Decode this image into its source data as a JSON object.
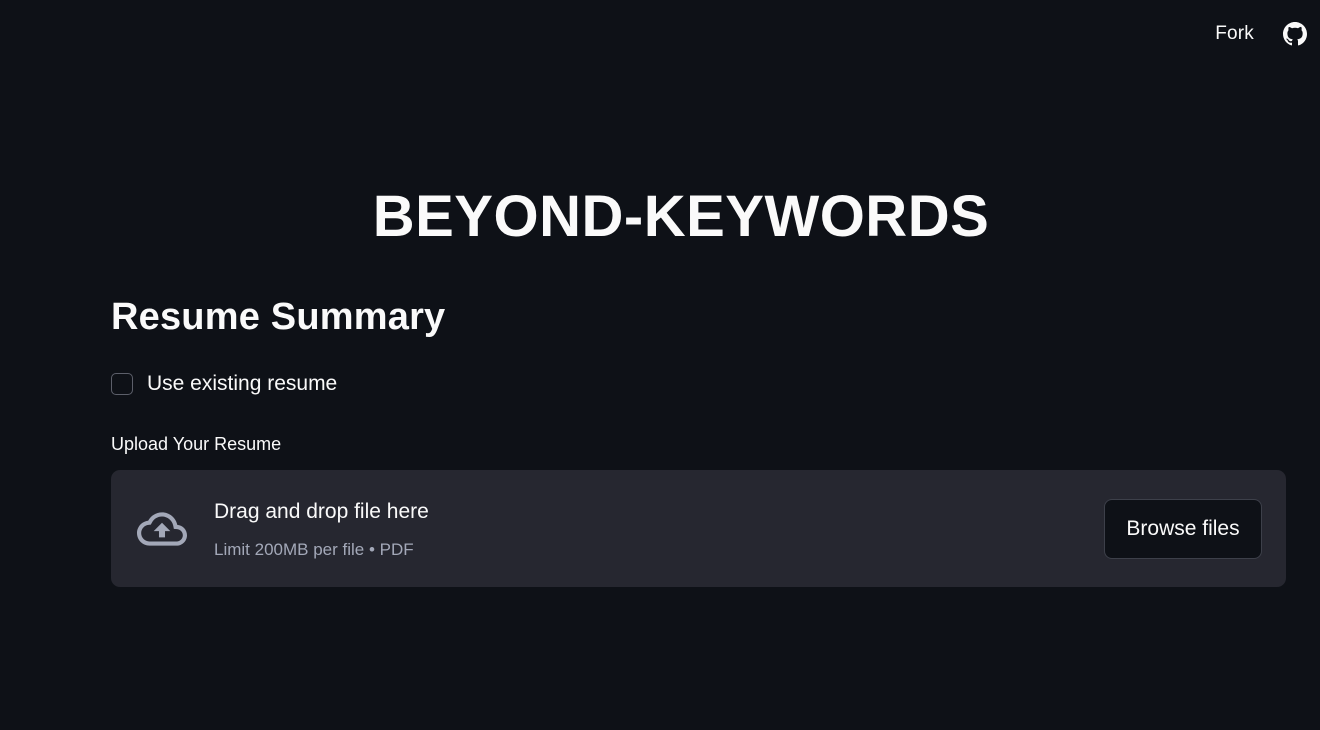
{
  "header": {
    "fork_label": "Fork",
    "github_icon": "github-icon"
  },
  "title": "BEYOND-KEYWORDS",
  "section": {
    "heading": "Resume Summary"
  },
  "checkbox": {
    "label": "Use existing resume",
    "checked": false
  },
  "uploader": {
    "label": "Upload Your Resume",
    "drop_text": "Drag and drop file here",
    "limit_text": "Limit 200MB per file • PDF",
    "browse_label": "Browse files",
    "icon": "cloud-upload-icon"
  },
  "colors": {
    "background": "#0e1117",
    "dropzone": "#262730",
    "text": "#fafafa",
    "muted": "#a3a8b8"
  }
}
